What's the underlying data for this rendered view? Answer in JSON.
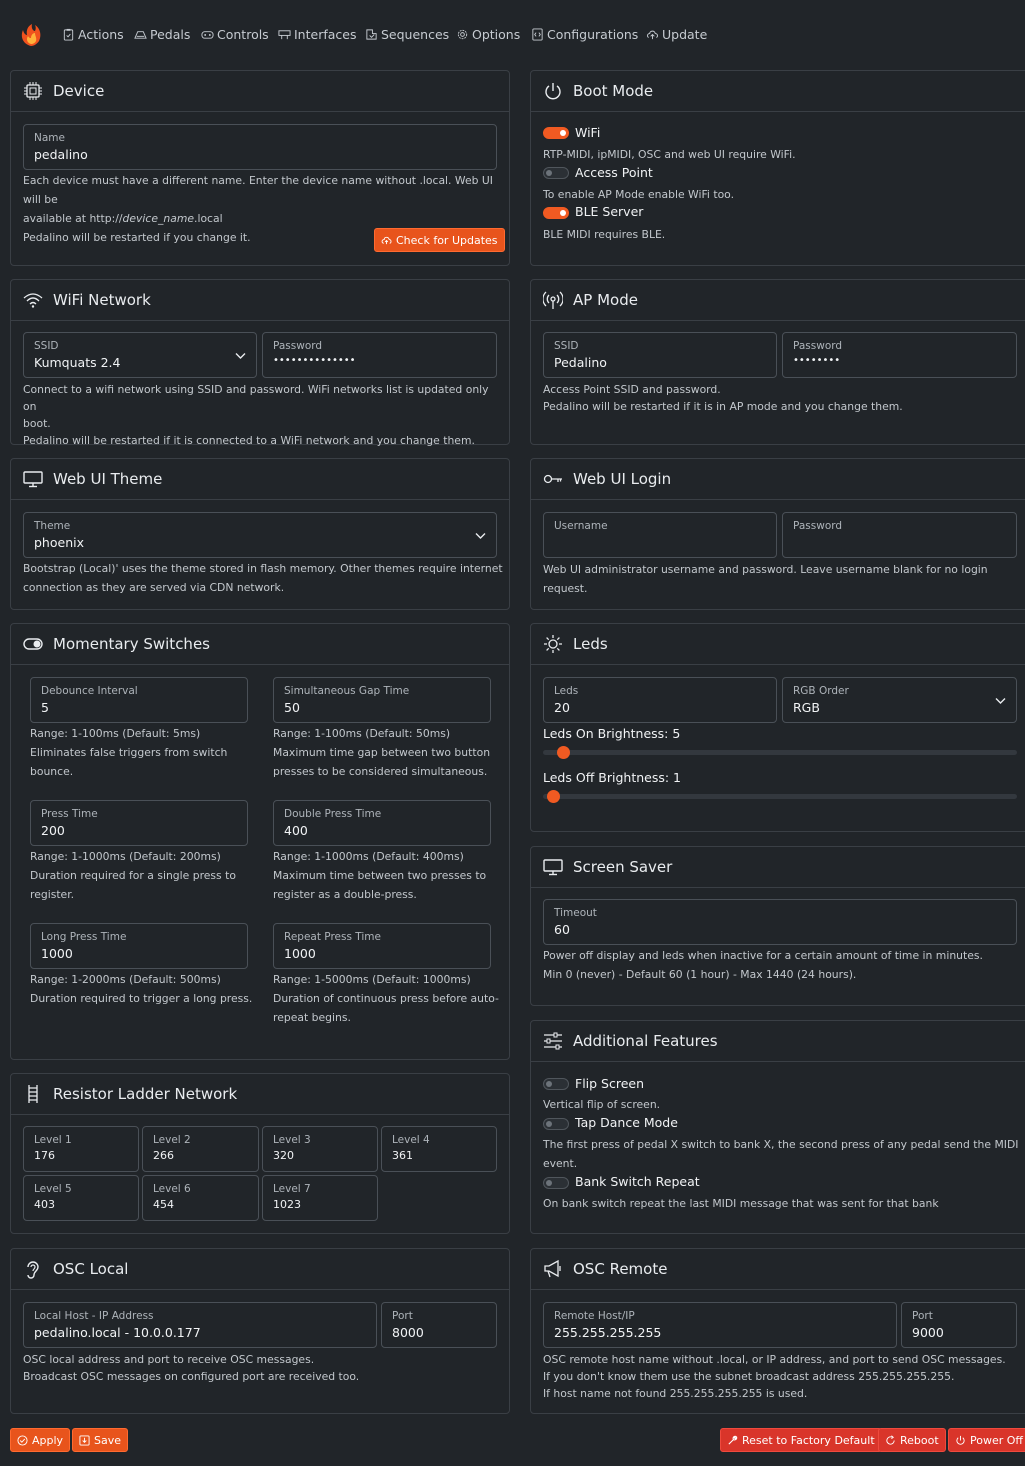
{
  "nav": {
    "items": [
      "Actions",
      "Pedals",
      "Controls",
      "Interfaces",
      "Sequences",
      "Options",
      "Configurations",
      "Update"
    ]
  },
  "device": {
    "title": "Device",
    "name_label": "Name",
    "name_value": "pedalino",
    "help1": "Each device must have a different name. Enter the device name without .local. Web UI will be",
    "help2_prefix": "available at http://",
    "help2_em": "device_name",
    "help2_suffix": ".local",
    "help3": "Pedalino will be restarted if you change it.",
    "check_updates": "Check for Updates"
  },
  "boot": {
    "title": "Boot Mode",
    "wifi_label": "WiFi",
    "wifi_help": "RTP-MIDI, ipMIDI, OSC and web UI require WiFi.",
    "ap_label": "Access Point",
    "ap_help": "To enable AP Mode enable WiFi too.",
    "ble_label": "BLE Server",
    "ble_help": "BLE MIDI requires BLE."
  },
  "wifi": {
    "title": "WiFi Network",
    "ssid_label": "SSID",
    "ssid_value": "Kumquats 2.4",
    "password_label": "Password",
    "password_value": "••••••••••••••",
    "help1": "Connect to a wifi network using SSID and password. WiFi networks list is updated only on",
    "help2": "boot.",
    "help3": "Pedalino will be restarted if it is connected to a WiFi network and you change them."
  },
  "apmode": {
    "title": "AP Mode",
    "ssid_label": "SSID",
    "ssid_value": "Pedalino",
    "password_label": "Password",
    "password_value": "••••••••",
    "help1": "Access Point SSID and password.",
    "help2": "Pedalino will be restarted if it is in AP mode and you change them."
  },
  "theme": {
    "title": "Web UI Theme",
    "label": "Theme",
    "value": "phoenix",
    "help1": "Bootstrap (Local)' uses the theme stored in flash memory. Other themes require internet",
    "help2": "connection as they are served via CDN network."
  },
  "login": {
    "title": "Web UI Login",
    "username_label": "Username",
    "password_label": "Password",
    "help": "Web UI administrator username and password. Leave username blank for no login request."
  },
  "momentary": {
    "title": "Momentary Switches",
    "debounce": {
      "label": "Debounce Interval",
      "value": "5",
      "range": "Range: 1-100ms (Default: 5ms)",
      "help1": "Eliminates false triggers from switch",
      "help2": "bounce."
    },
    "simgap": {
      "label": "Simultaneous Gap Time",
      "value": "50",
      "range": "Range: 1-100ms (Default: 50ms)",
      "help1": "Maximum time gap between two button",
      "help2": "presses to be considered simultaneous."
    },
    "press": {
      "label": "Press Time",
      "value": "200",
      "range": "Range: 1-1000ms (Default: 200ms)",
      "help1": "Duration required for a single press to",
      "help2": "register."
    },
    "double": {
      "label": "Double Press Time",
      "value": "400",
      "range": "Range: 1-1000ms (Default: 400ms)",
      "help1": "Maximum time between two presses to",
      "help2": "register as a double-press."
    },
    "long": {
      "label": "Long Press Time",
      "value": "1000",
      "range": "Range: 1-2000ms (Default: 500ms)",
      "help1": "Duration required to trigger a long press."
    },
    "repeat": {
      "label": "Repeat Press Time",
      "value": "1000",
      "range": "Range: 1-5000ms (Default: 1000ms)",
      "help1": "Duration of continuous press before auto-",
      "help2": "repeat begins."
    }
  },
  "leds": {
    "title": "Leds",
    "leds_label": "Leds",
    "leds_value": "20",
    "rgb_label": "RGB Order",
    "rgb_value": "RGB",
    "on_label": "Leds On Brightness: 5",
    "on_level": 5,
    "off_label": "Leds Off Brightness: 1",
    "off_level": 1
  },
  "screensaver": {
    "title": "Screen Saver",
    "label": "Timeout",
    "value": "60",
    "help1": "Power off display and leds when inactive for a certain amount of time in minutes.",
    "help2": "Min 0 (never) - Default 60 (1 hour) - Max 1440 (24 hours)."
  },
  "features": {
    "title": "Additional Features",
    "flip_label": "Flip Screen",
    "flip_help": "Vertical flip of screen.",
    "tap_label": "Tap Dance Mode",
    "tap_help1": "The first press of pedal X switch to bank X, the second press of any pedal send the MIDI",
    "tap_help2": "event.",
    "bank_label": "Bank Switch Repeat",
    "bank_help": "On bank switch repeat the last MIDI message that was sent for that bank"
  },
  "ladder": {
    "title": "Resistor Ladder Network",
    "levels": [
      {
        "label": "Level 1",
        "value": "176"
      },
      {
        "label": "Level 2",
        "value": "266"
      },
      {
        "label": "Level 3",
        "value": "320"
      },
      {
        "label": "Level 4",
        "value": "361"
      },
      {
        "label": "Level 5",
        "value": "403"
      },
      {
        "label": "Level 6",
        "value": "454"
      },
      {
        "label": "Level 7",
        "value": "1023"
      }
    ]
  },
  "osclocal": {
    "title": "OSC Local",
    "host_label": "Local Host - IP Address",
    "host_value": "pedalino.local - 10.0.0.177",
    "port_label": "Port",
    "port_value": "8000",
    "help1": "OSC local address and port to receive OSC messages.",
    "help2": "Broadcast OSC messages on configured port are received too."
  },
  "oscremote": {
    "title": "OSC Remote",
    "host_label": "Remote Host/IP",
    "host_value": "255.255.255.255",
    "port_label": "Port",
    "port_value": "9000",
    "help1": "OSC remote host name without .local, or IP address, and port to send OSC messages.",
    "help2": "If you don't know them use the subnet broadcast address 255.255.255.255.",
    "help3": "If host name not found 255.255.255.255 is used."
  },
  "footer": {
    "apply": "Apply",
    "save": "Save",
    "reset": "Reset to Factory Default",
    "reboot": "Reboot",
    "poweroff": "Power Off"
  },
  "colors": {
    "accent": "#f05a22",
    "danger": "#d9352a",
    "background": "#212529"
  }
}
